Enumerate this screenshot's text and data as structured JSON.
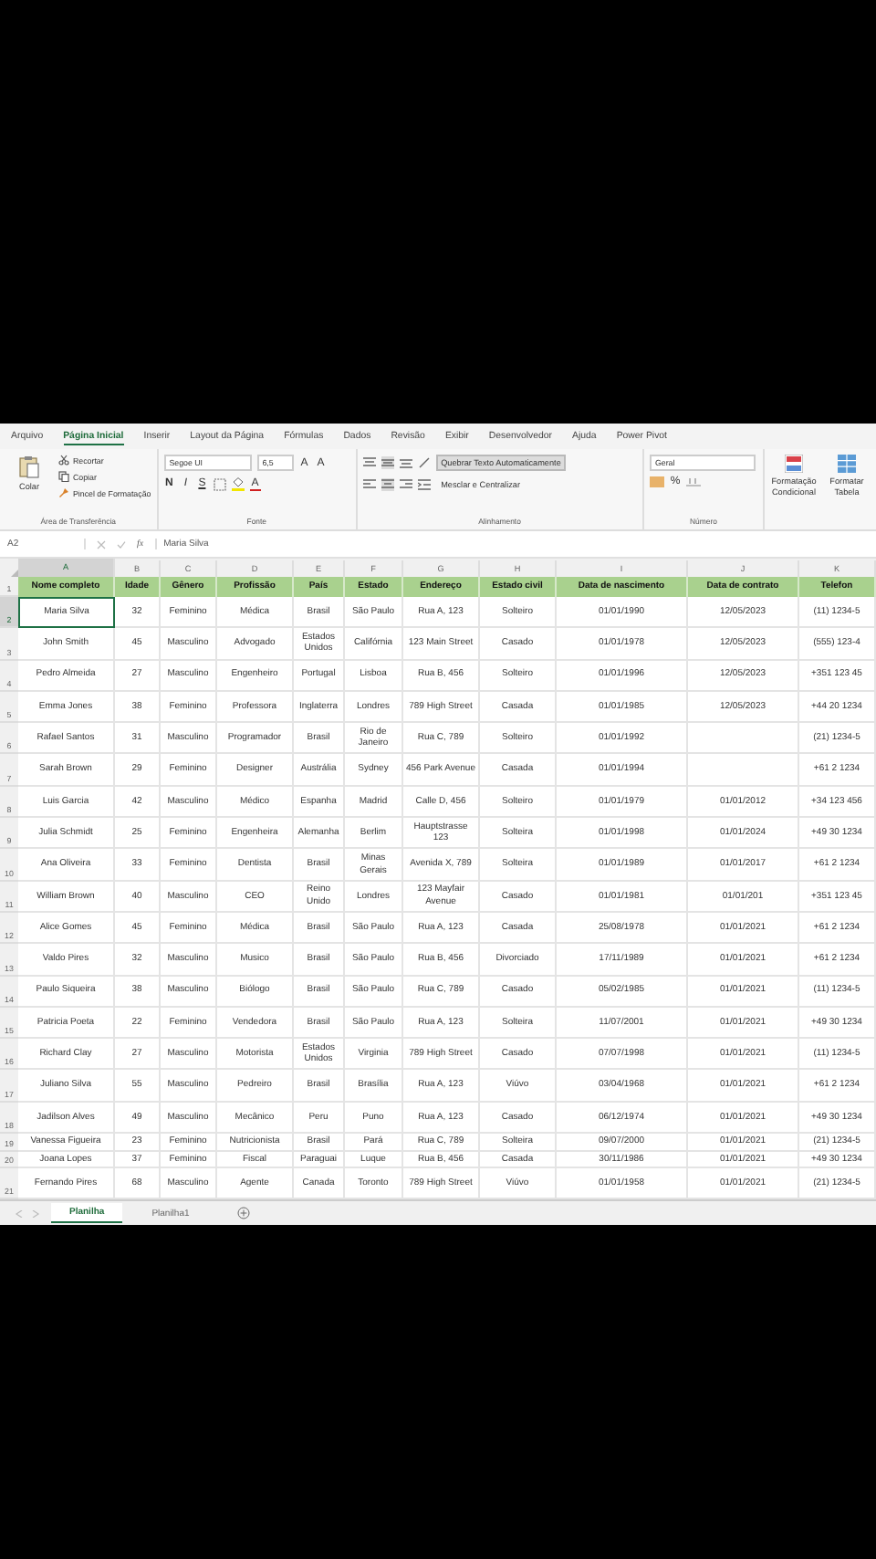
{
  "ribbon": {
    "tabs": [
      {
        "label": "Arquivo",
        "selected": false
      },
      {
        "label": "Página Inicial",
        "selected": true
      },
      {
        "label": "Inserir",
        "selected": false
      },
      {
        "label": "Layout da Página",
        "selected": false
      },
      {
        "label": "Fórmulas",
        "selected": false
      },
      {
        "label": "Dados",
        "selected": false
      },
      {
        "label": "Revisão",
        "selected": false
      },
      {
        "label": "Exibir",
        "selected": false
      },
      {
        "label": "Desenvolvedor",
        "selected": false
      },
      {
        "label": "Ajuda",
        "selected": false
      },
      {
        "label": "Power Pivot",
        "selected": false
      }
    ],
    "clipboard": {
      "label": "Área de Transferência",
      "paste": "Colar",
      "cut": "Recortar",
      "copy": "Copiar",
      "painter": "Pincel de Formatação"
    },
    "font": {
      "label": "Fonte",
      "family": "Segoe UI",
      "size": "6,5",
      "grow": "A",
      "shrink": "A",
      "bold": "N",
      "italic": "I",
      "underline": "S",
      "color_letter": "A"
    },
    "alignment": {
      "label": "Alinhamento",
      "wrap_text": {
        "label": "Quebrar Texto Automaticamente",
        "on": true
      },
      "merge": "Mesclar e Centralizar"
    },
    "number": {
      "label": "Número",
      "format": "Geral",
      "percent": "%"
    },
    "styles": {
      "conditional": "Formatação Condicional",
      "table": "Formatar Tabela"
    }
  },
  "formula_bar": {
    "name_box": "A2",
    "fx": "fx",
    "value": "Maria Silva"
  },
  "columns": [
    {
      "letter": "A",
      "title": "Nome completo",
      "selected": true
    },
    {
      "letter": "B",
      "title": "Idade",
      "selected": false
    },
    {
      "letter": "C",
      "title": "Gênero",
      "selected": false
    },
    {
      "letter": "D",
      "title": "Profissão",
      "selected": false
    },
    {
      "letter": "E",
      "title": "País",
      "selected": false
    },
    {
      "letter": "F",
      "title": "Estado",
      "selected": false
    },
    {
      "letter": "G",
      "title": "Endereço",
      "selected": false
    },
    {
      "letter": "H",
      "title": "Estado civil",
      "selected": false
    },
    {
      "letter": "I",
      "title": "Data de nascimento",
      "selected": false
    },
    {
      "letter": "J",
      "title": "Data de contrato",
      "selected": false
    },
    {
      "letter": "K",
      "title": "Telefon",
      "selected": false
    }
  ],
  "header_row_number": "1",
  "rows": [
    {
      "number": "2",
      "selected": true,
      "compact": false,
      "cells": [
        "Maria Silva",
        "32",
        "Feminino",
        "Médica",
        "Brasil",
        "São Paulo",
        "Rua A, 123",
        "Solteiro",
        "01/01/1990",
        "12/05/2023",
        "(11) 1234-5"
      ]
    },
    {
      "number": "3",
      "selected": false,
      "compact": false,
      "cells": [
        "John Smith",
        "45",
        "Masculino",
        "Advogado",
        "Estados Unidos",
        "Califórnia",
        "123 Main Street",
        "Casado",
        "01/01/1978",
        "12/05/2023",
        "(555) 123-4"
      ]
    },
    {
      "number": "4",
      "selected": false,
      "compact": false,
      "cells": [
        "Pedro Almeida",
        "27",
        "Masculino",
        "Engenheiro",
        "Portugal",
        "Lisboa",
        "Rua B, 456",
        "Solteiro",
        "01/01/1996",
        "12/05/2023",
        "+351 123 45"
      ]
    },
    {
      "number": "5",
      "selected": false,
      "compact": false,
      "cells": [
        "Emma Jones",
        "38",
        "Feminino",
        "Professora",
        "Inglaterra",
        "Londres",
        "789 High Street",
        "Casada",
        "01/01/1985",
        "12/05/2023",
        "+44 20 1234"
      ]
    },
    {
      "number": "6",
      "selected": false,
      "compact": false,
      "cells": [
        "Rafael Santos",
        "31",
        "Masculino",
        "Programador",
        "Brasil",
        "Rio de Janeiro",
        "Rua C, 789",
        "Solteiro",
        "01/01/1992",
        null,
        "(21) 1234-5"
      ]
    },
    {
      "number": "7",
      "selected": false,
      "compact": false,
      "cells": [
        "Sarah Brown",
        "29",
        "Feminino",
        "Designer",
        "Austrália",
        "Sydney",
        "456 Park Avenue",
        "Casada",
        "01/01/1994",
        null,
        "+61 2 1234"
      ]
    },
    {
      "number": "8",
      "selected": false,
      "compact": false,
      "cells": [
        "Luis Garcia",
        "42",
        "Masculino",
        "Médico",
        "Espanha",
        "Madrid",
        "Calle D, 456",
        "Solteiro",
        "01/01/1979",
        "01/01/2012",
        "+34 123 456"
      ]
    },
    {
      "number": "9",
      "selected": false,
      "compact": false,
      "cells": [
        "Julia Schmidt",
        "25",
        "Feminino",
        "Engenheira",
        "Alemanha",
        "Berlim",
        "Hauptstrasse 123",
        "Solteira",
        "01/01/1998",
        "01/01/2024",
        "+49 30 1234"
      ]
    },
    {
      "number": "10",
      "selected": false,
      "compact": false,
      "cells": [
        "Ana Oliveira",
        "33",
        "Feminino",
        "Dentista",
        "Brasil",
        "Minas Gerais",
        "Avenida X, 789",
        "Solteira",
        "01/01/1989",
        "01/01/2017",
        "+61 2 1234"
      ]
    },
    {
      "number": "11",
      "selected": false,
      "compact": false,
      "cells": [
        "William Brown",
        "40",
        "Masculino",
        "CEO",
        "Reino Unido",
        "Londres",
        "123 Mayfair Avenue",
        "Casado",
        "01/01/1981",
        "01/01/201",
        "+351 123 45"
      ]
    },
    {
      "number": "12",
      "selected": false,
      "compact": false,
      "cells": [
        "Alice Gomes",
        "45",
        "Feminino",
        "Médica",
        "Brasil",
        "São Paulo",
        "Rua A, 123",
        "Casada",
        "25/08/1978",
        "01/01/2021",
        "+61 2 1234"
      ]
    },
    {
      "number": "13",
      "selected": false,
      "compact": false,
      "cells": [
        "Valdo Pires",
        "32",
        "Masculino",
        "Musico",
        "Brasil",
        "São Paulo",
        "Rua B, 456",
        "Divorciado",
        "17/11/1989",
        "01/01/2021",
        "+61 2 1234"
      ]
    },
    {
      "number": "14",
      "selected": false,
      "compact": false,
      "cells": [
        "Paulo Siqueira",
        "38",
        "Masculino",
        "Biólogo",
        "Brasil",
        "São Paulo",
        "Rua C, 789",
        "Casado",
        "05/02/1985",
        "01/01/2021",
        "(11) 1234-5"
      ]
    },
    {
      "number": "15",
      "selected": false,
      "compact": false,
      "cells": [
        "Patricia Poeta",
        "22",
        "Feminino",
        "Vendedora",
        "Brasil",
        "São Paulo",
        "Rua A, 123",
        "Solteira",
        "11/07/2001",
        "01/01/2021",
        "+49 30 1234"
      ]
    },
    {
      "number": "16",
      "selected": false,
      "compact": false,
      "cells": [
        "Richard Clay",
        "27",
        "Masculino",
        "Motorista",
        "Estados Unidos",
        "Virginia",
        "789 High Street",
        "Casado",
        "07/07/1998",
        "01/01/2021",
        "(11) 1234-5"
      ]
    },
    {
      "number": "17",
      "selected": false,
      "compact": false,
      "cells": [
        "Juliano Silva",
        "55",
        "Masculino",
        "Pedreiro",
        "Brasil",
        "Brasília",
        "Rua A, 123",
        "Viúvo",
        "03/04/1968",
        "01/01/2021",
        "+61 2 1234"
      ]
    },
    {
      "number": "18",
      "selected": false,
      "compact": false,
      "cells": [
        "Jadilson Alves",
        "49",
        "Masculino",
        "Mecânico",
        "Peru",
        "Puno",
        "Rua A, 123",
        "Casado",
        "06/12/1974",
        "01/01/2021",
        "+49 30 1234"
      ]
    },
    {
      "number": "19",
      "selected": false,
      "compact": true,
      "cells": [
        "Vanessa Figueira",
        "23",
        "Feminino",
        "Nutricionista",
        "Brasil",
        "Pará",
        "Rua C, 789",
        "Solteira",
        "09/07/2000",
        "01/01/2021",
        "(21) 1234-5"
      ]
    },
    {
      "number": "20",
      "selected": false,
      "compact": true,
      "cells": [
        "Joana Lopes",
        "37",
        "Feminino",
        "Fiscal",
        "Paraguai",
        "Luque",
        "Rua B, 456",
        "Casada",
        "30/11/1986",
        "01/01/2021",
        "+49 30 1234"
      ]
    },
    {
      "number": "21",
      "selected": false,
      "compact": false,
      "cells": [
        "Fernando Pires",
        "68",
        "Masculino",
        "Agente",
        "Canada",
        "Toronto",
        "789 High Street",
        "Viúvo",
        "01/01/1958",
        "01/01/2021",
        "(21) 1234-5"
      ]
    }
  ],
  "sheet_tabs": [
    {
      "label": "Planilha",
      "selected": true
    },
    {
      "label": "Planilha1",
      "selected": false
    }
  ]
}
